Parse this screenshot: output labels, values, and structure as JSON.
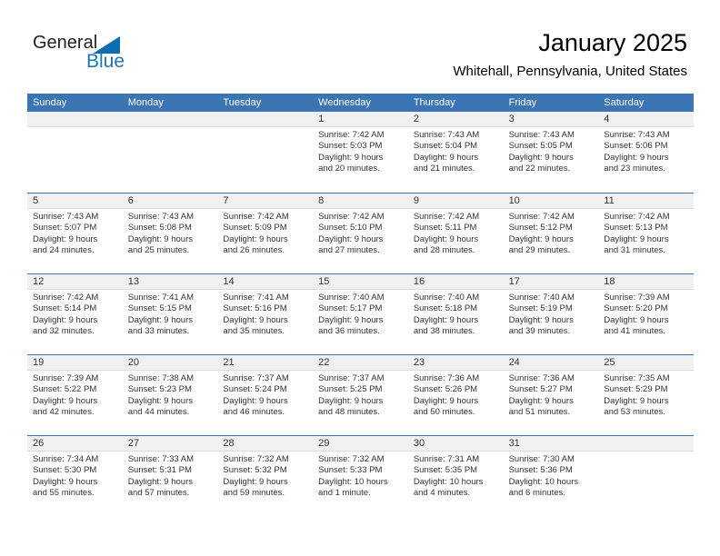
{
  "brand": {
    "name_part1": "General",
    "name_part2": "Blue",
    "triangle_icon": "triangle-icon",
    "accent_color": "#1b75bc"
  },
  "header": {
    "month_title": "January 2025",
    "location": "Whitehall, Pennsylvania, United States"
  },
  "calendar": {
    "header_bg": "#3b75b4",
    "daynum_band_bg": "#f0f0f0",
    "weekdays": [
      "Sunday",
      "Monday",
      "Tuesday",
      "Wednesday",
      "Thursday",
      "Friday",
      "Saturday"
    ],
    "weeks": [
      [
        {
          "empty": true
        },
        {
          "empty": true
        },
        {
          "empty": true
        },
        {
          "day": "1",
          "l1": "Sunrise: 7:42 AM",
          "l2": "Sunset: 5:03 PM",
          "l3": "Daylight: 9 hours",
          "l4": "and 20 minutes."
        },
        {
          "day": "2",
          "l1": "Sunrise: 7:43 AM",
          "l2": "Sunset: 5:04 PM",
          "l3": "Daylight: 9 hours",
          "l4": "and 21 minutes."
        },
        {
          "day": "3",
          "l1": "Sunrise: 7:43 AM",
          "l2": "Sunset: 5:05 PM",
          "l3": "Daylight: 9 hours",
          "l4": "and 22 minutes."
        },
        {
          "day": "4",
          "l1": "Sunrise: 7:43 AM",
          "l2": "Sunset: 5:06 PM",
          "l3": "Daylight: 9 hours",
          "l4": "and 23 minutes."
        }
      ],
      [
        {
          "day": "5",
          "l1": "Sunrise: 7:43 AM",
          "l2": "Sunset: 5:07 PM",
          "l3": "Daylight: 9 hours",
          "l4": "and 24 minutes."
        },
        {
          "day": "6",
          "l1": "Sunrise: 7:43 AM",
          "l2": "Sunset: 5:08 PM",
          "l3": "Daylight: 9 hours",
          "l4": "and 25 minutes."
        },
        {
          "day": "7",
          "l1": "Sunrise: 7:42 AM",
          "l2": "Sunset: 5:09 PM",
          "l3": "Daylight: 9 hours",
          "l4": "and 26 minutes."
        },
        {
          "day": "8",
          "l1": "Sunrise: 7:42 AM",
          "l2": "Sunset: 5:10 PM",
          "l3": "Daylight: 9 hours",
          "l4": "and 27 minutes."
        },
        {
          "day": "9",
          "l1": "Sunrise: 7:42 AM",
          "l2": "Sunset: 5:11 PM",
          "l3": "Daylight: 9 hours",
          "l4": "and 28 minutes."
        },
        {
          "day": "10",
          "l1": "Sunrise: 7:42 AM",
          "l2": "Sunset: 5:12 PM",
          "l3": "Daylight: 9 hours",
          "l4": "and 29 minutes."
        },
        {
          "day": "11",
          "l1": "Sunrise: 7:42 AM",
          "l2": "Sunset: 5:13 PM",
          "l3": "Daylight: 9 hours",
          "l4": "and 31 minutes."
        }
      ],
      [
        {
          "day": "12",
          "l1": "Sunrise: 7:42 AM",
          "l2": "Sunset: 5:14 PM",
          "l3": "Daylight: 9 hours",
          "l4": "and 32 minutes."
        },
        {
          "day": "13",
          "l1": "Sunrise: 7:41 AM",
          "l2": "Sunset: 5:15 PM",
          "l3": "Daylight: 9 hours",
          "l4": "and 33 minutes."
        },
        {
          "day": "14",
          "l1": "Sunrise: 7:41 AM",
          "l2": "Sunset: 5:16 PM",
          "l3": "Daylight: 9 hours",
          "l4": "and 35 minutes."
        },
        {
          "day": "15",
          "l1": "Sunrise: 7:40 AM",
          "l2": "Sunset: 5:17 PM",
          "l3": "Daylight: 9 hours",
          "l4": "and 36 minutes."
        },
        {
          "day": "16",
          "l1": "Sunrise: 7:40 AM",
          "l2": "Sunset: 5:18 PM",
          "l3": "Daylight: 9 hours",
          "l4": "and 38 minutes."
        },
        {
          "day": "17",
          "l1": "Sunrise: 7:40 AM",
          "l2": "Sunset: 5:19 PM",
          "l3": "Daylight: 9 hours",
          "l4": "and 39 minutes."
        },
        {
          "day": "18",
          "l1": "Sunrise: 7:39 AM",
          "l2": "Sunset: 5:20 PM",
          "l3": "Daylight: 9 hours",
          "l4": "and 41 minutes."
        }
      ],
      [
        {
          "day": "19",
          "l1": "Sunrise: 7:39 AM",
          "l2": "Sunset: 5:22 PM",
          "l3": "Daylight: 9 hours",
          "l4": "and 42 minutes."
        },
        {
          "day": "20",
          "l1": "Sunrise: 7:38 AM",
          "l2": "Sunset: 5:23 PM",
          "l3": "Daylight: 9 hours",
          "l4": "and 44 minutes."
        },
        {
          "day": "21",
          "l1": "Sunrise: 7:37 AM",
          "l2": "Sunset: 5:24 PM",
          "l3": "Daylight: 9 hours",
          "l4": "and 46 minutes."
        },
        {
          "day": "22",
          "l1": "Sunrise: 7:37 AM",
          "l2": "Sunset: 5:25 PM",
          "l3": "Daylight: 9 hours",
          "l4": "and 48 minutes."
        },
        {
          "day": "23",
          "l1": "Sunrise: 7:36 AM",
          "l2": "Sunset: 5:26 PM",
          "l3": "Daylight: 9 hours",
          "l4": "and 50 minutes."
        },
        {
          "day": "24",
          "l1": "Sunrise: 7:36 AM",
          "l2": "Sunset: 5:27 PM",
          "l3": "Daylight: 9 hours",
          "l4": "and 51 minutes."
        },
        {
          "day": "25",
          "l1": "Sunrise: 7:35 AM",
          "l2": "Sunset: 5:29 PM",
          "l3": "Daylight: 9 hours",
          "l4": "and 53 minutes."
        }
      ],
      [
        {
          "day": "26",
          "l1": "Sunrise: 7:34 AM",
          "l2": "Sunset: 5:30 PM",
          "l3": "Daylight: 9 hours",
          "l4": "and 55 minutes."
        },
        {
          "day": "27",
          "l1": "Sunrise: 7:33 AM",
          "l2": "Sunset: 5:31 PM",
          "l3": "Daylight: 9 hours",
          "l4": "and 57 minutes."
        },
        {
          "day": "28",
          "l1": "Sunrise: 7:32 AM",
          "l2": "Sunset: 5:32 PM",
          "l3": "Daylight: 9 hours",
          "l4": "and 59 minutes."
        },
        {
          "day": "29",
          "l1": "Sunrise: 7:32 AM",
          "l2": "Sunset: 5:33 PM",
          "l3": "Daylight: 10 hours",
          "l4": "and 1 minute."
        },
        {
          "day": "30",
          "l1": "Sunrise: 7:31 AM",
          "l2": "Sunset: 5:35 PM",
          "l3": "Daylight: 10 hours",
          "l4": "and 4 minutes."
        },
        {
          "day": "31",
          "l1": "Sunrise: 7:30 AM",
          "l2": "Sunset: 5:36 PM",
          "l3": "Daylight: 10 hours",
          "l4": "and 6 minutes."
        },
        {
          "empty": true
        }
      ]
    ]
  }
}
